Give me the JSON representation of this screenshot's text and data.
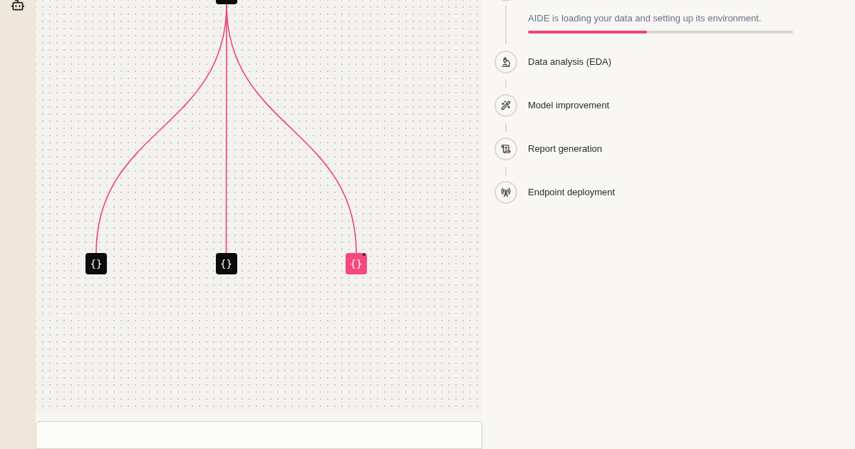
{
  "canvas": {
    "tree": {
      "selected": false,
      "children": [
        {
          "label": "{}",
          "selected": false
        },
        {
          "label": "{}",
          "selected": false
        },
        {
          "label": "{}",
          "selected": true,
          "badge": "*"
        }
      ]
    }
  },
  "timeline": {
    "current_step": {
      "description": "AIDE is loading your data and setting up its environment.",
      "level": 0.45
    },
    "steps": [
      {
        "label": "Data analysis (EDA)"
      },
      {
        "label": "Model improvement"
      },
      {
        "label": "Report generation"
      },
      {
        "label": "Endpoint deployment"
      }
    ]
  }
}
